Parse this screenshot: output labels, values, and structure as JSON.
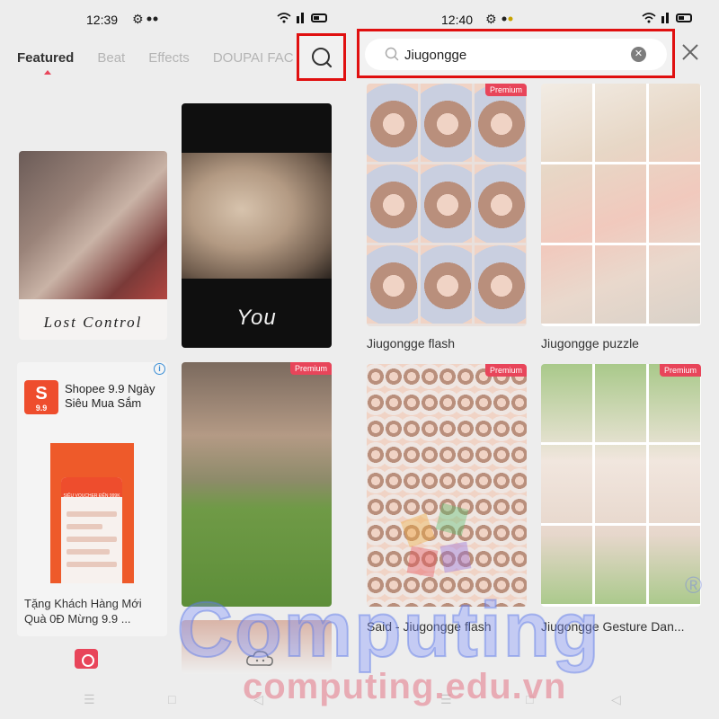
{
  "left": {
    "status": {
      "time": "12:39"
    },
    "tabs": [
      {
        "label": "Featured",
        "active": true
      },
      {
        "label": "Beat",
        "active": false
      },
      {
        "label": "Effects",
        "active": false
      },
      {
        "label": "DOUPAI FAC",
        "active": false
      }
    ],
    "search_icon": "search-icon",
    "feed": {
      "lost_control": {
        "caption": "Lost Control"
      },
      "you": {
        "caption": "You"
      },
      "ad": {
        "title": "Shopee 9.9 Ngày Siêu Mua Sắm",
        "logo_text": "S",
        "logo_sub": "9.9",
        "description": "Tặng Khách Hàng Mới Quà 0Đ Mừng 9.9 ...",
        "banner_text": "SIÊU VOUCHER ĐẾN 999K"
      },
      "kick": {
        "badge": "Premium"
      }
    },
    "bottom_nav": {
      "home_icon": "home-icon",
      "cloud_icon": "cloud-icon"
    }
  },
  "right": {
    "status": {
      "time": "12:40"
    },
    "search": {
      "value": "Jiugongge",
      "placeholder": ""
    },
    "results": [
      {
        "label": "Jiugongge flash",
        "badge": "Premium"
      },
      {
        "label": "Jiugongge puzzle",
        "badge": ""
      },
      {
        "label": "Said - Jiugongge flash",
        "badge": "Premium"
      },
      {
        "label": "Jiugongge Gesture Dan...",
        "badge": "Premium"
      }
    ]
  },
  "watermark": {
    "word": "Computing",
    "url": "computing.edu.vn",
    "reg": "®"
  },
  "colors": {
    "accent": "#e8455a",
    "highlight": "#e01010",
    "shopee": "#ee4d2d"
  }
}
